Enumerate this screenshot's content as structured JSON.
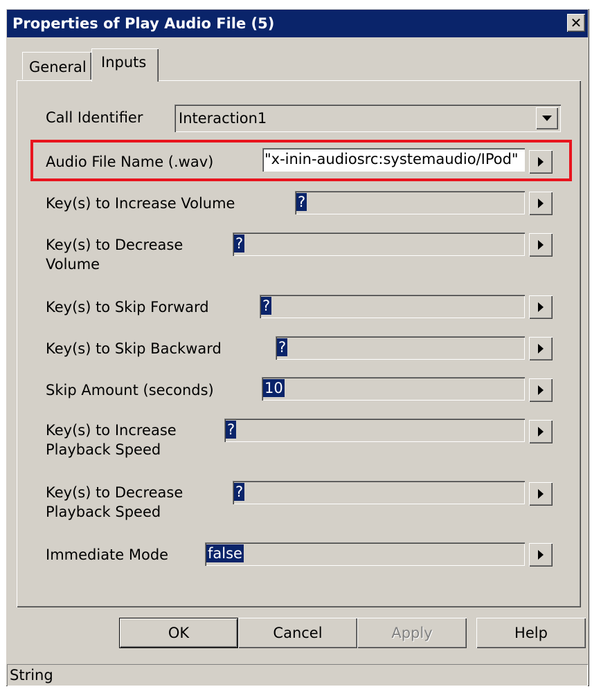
{
  "window": {
    "title": "Properties of Play Audio File (5)",
    "close_glyph": "✕"
  },
  "tabs": [
    {
      "label": "General",
      "active": false
    },
    {
      "label": "Inputs",
      "active": true
    }
  ],
  "call_identifier": {
    "label": "Call Identifier",
    "value": "Interaction1"
  },
  "fields": [
    {
      "label": "Audio File Name (.wav)",
      "value": "\"x-inin-audiosrc:systemaudio/IPod\""
    },
    {
      "label": "Key(s) to Increase Volume",
      "value": "?"
    },
    {
      "label_line1": "Key(s) to Decrease",
      "label_line2": "Volume",
      "value": "?"
    },
    {
      "label": "Key(s) to Skip Forward",
      "value": "?"
    },
    {
      "label": "Key(s) to Skip Backward",
      "value": "?"
    },
    {
      "label": "Skip Amount (seconds)",
      "value": "10"
    },
    {
      "label_line1": "Key(s) to Increase",
      "label_line2": "Playback Speed",
      "value": "?"
    },
    {
      "label_line1": "Key(s) to Decrease",
      "label_line2": "Playback Speed",
      "value": "?"
    },
    {
      "label": "Immediate Mode",
      "value": "false"
    }
  ],
  "buttons": {
    "ok": "OK",
    "cancel": "Cancel",
    "apply": "Apply",
    "help": "Help"
  },
  "status_text": "String",
  "colors": {
    "title_bar": "#0a246a",
    "dialog_face": "#d4d0c8",
    "selection": "#0a246a",
    "highlight_box": "#e8141e"
  },
  "icons": {
    "combo_dropdown": "chevron-down-icon",
    "field_expand": "play-arrow-icon",
    "close": "close-icon"
  }
}
